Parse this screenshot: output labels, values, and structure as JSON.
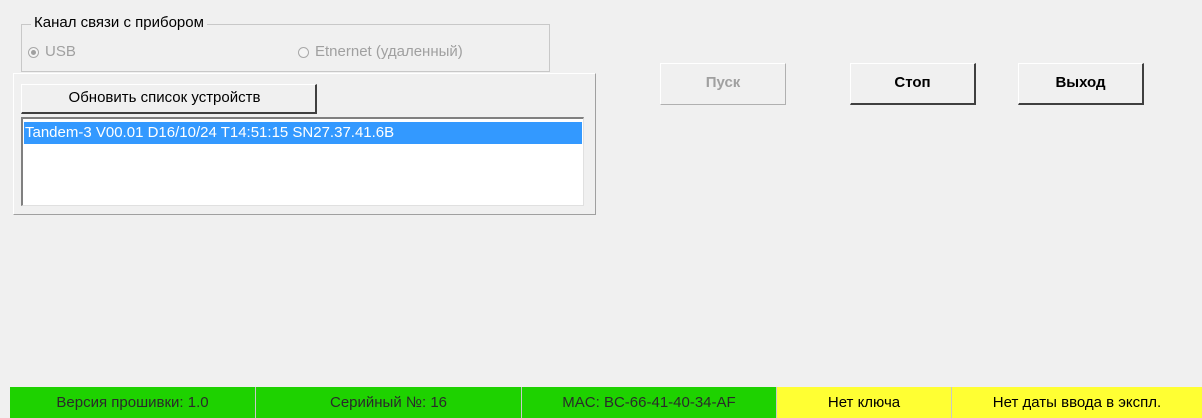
{
  "connection": {
    "group_title": "Канал связи с прибором",
    "options": [
      {
        "label": "USB",
        "checked": true,
        "enabled": false
      },
      {
        "label": "Etnernet (удаленный)",
        "checked": false,
        "enabled": false
      }
    ]
  },
  "devices": {
    "refresh_label": "Обновить список устройств",
    "items": [
      {
        "label": "Tandem-3 V00.01 D16/10/24 T14:51:15 SN27.37.41.6B",
        "selected": true
      }
    ]
  },
  "actions": {
    "start_label": "Пуск",
    "start_enabled": false,
    "stop_label": "Стоп",
    "exit_label": "Выход"
  },
  "status": {
    "firmware": "Версия прошивки: 1.0",
    "serial": "Серийный №: 16",
    "mac": "MAC: BC-66-41-40-34-AF",
    "key": "Нет ключа",
    "commission_date": "Нет даты ввода в экспл."
  },
  "colors": {
    "status_ok": "#1ed200",
    "status_warn": "#ffff33",
    "selection": "#3399ff"
  }
}
